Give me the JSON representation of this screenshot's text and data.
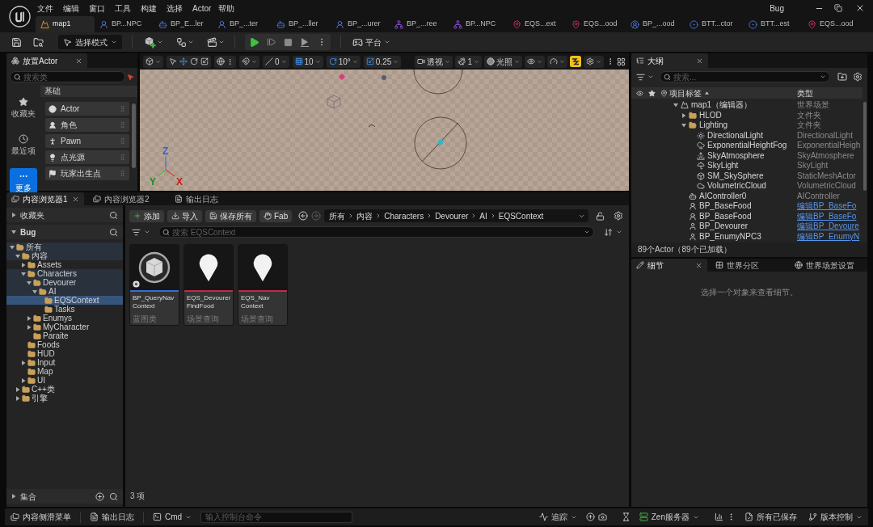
{
  "title_bar": {
    "menu": [
      "文件",
      "编辑",
      "窗口",
      "工具",
      "构建",
      "选择",
      "Actor",
      "帮助"
    ],
    "project": "Bug",
    "tabs": [
      {
        "label": "map1",
        "kind": "level",
        "selected": true
      },
      {
        "label": "BP...NPC",
        "kind": "character",
        "selected": false
      },
      {
        "label": "BP_E...ler",
        "kind": "controller",
        "selected": false
      },
      {
        "label": "BP_...ter",
        "kind": "character",
        "selected": false
      },
      {
        "label": "BP_...ller",
        "kind": "controller",
        "selected": false
      },
      {
        "label": "BP_...urer",
        "kind": "character",
        "selected": false
      },
      {
        "label": "BP_...ree",
        "kind": "behavior_tree",
        "selected": false
      },
      {
        "label": "BP...NPC",
        "kind": "behavior_tree",
        "selected": false
      },
      {
        "label": "EQS...ext",
        "kind": "query",
        "selected": false
      },
      {
        "label": "EQS...ood",
        "kind": "query",
        "selected": false
      },
      {
        "label": "BP_...ood",
        "kind": "blackboard",
        "selected": false
      },
      {
        "label": "BTT...ctor",
        "kind": "task",
        "selected": false
      },
      {
        "label": "BTT...est",
        "kind": "task",
        "selected": false
      },
      {
        "label": "EQS...ood",
        "kind": "query",
        "selected": false
      }
    ]
  },
  "main_toolbar": {
    "mode": "选择模式",
    "platforms": "平台"
  },
  "place_actors": {
    "tab": "放置Actor",
    "search_placeholder": "搜索类",
    "categories": [
      {
        "label": "收藏夹",
        "kind": "favorites",
        "selected": false
      },
      {
        "label": "最近项",
        "kind": "recent",
        "selected": false
      },
      {
        "label": "更多",
        "kind": "more",
        "selected": true
      }
    ],
    "section": "基础",
    "items": [
      {
        "label": "Actor",
        "kind": "actor"
      },
      {
        "label": "角色",
        "kind": "character"
      },
      {
        "label": "Pawn",
        "kind": "pawn"
      },
      {
        "label": "点光源",
        "kind": "point_light"
      },
      {
        "label": "玩家出生点",
        "kind": "player_start"
      }
    ]
  },
  "viewport": {
    "toolbar": {
      "surface_snap": "0",
      "grid_snap": "10",
      "rotation_snap": "10°",
      "scale_snap": "0.25",
      "view_mode": "透视",
      "camera_speed": "1",
      "lighting_mode": "光照"
    },
    "axis_labels": [
      {
        "label": "Z",
        "color": "#2f5fd8"
      },
      {
        "label": "Y",
        "color": "#1f8a1f"
      },
      {
        "label": "X",
        "color": "#c81e1e"
      }
    ]
  },
  "content_browser": {
    "tabs": [
      {
        "label": "内容浏览器1",
        "kind": "browser",
        "selected": true
      },
      {
        "label": "内容浏览器2",
        "kind": "browser",
        "selected": false
      },
      {
        "label": "输出日志",
        "kind": "log",
        "selected": false
      }
    ],
    "sources": {
      "favorites": {
        "label": "收藏夹",
        "expanded": false
      },
      "project": {
        "label": "Bug",
        "expanded": true
      },
      "tree": [
        {
          "label": "所有",
          "expanded": true,
          "selected": false,
          "highlighted": true,
          "children": [
            {
              "label": "内容",
              "expanded": true,
              "selected": false,
              "highlighted": true,
              "children": [
                {
                  "label": "Assets",
                  "expanded": false,
                  "selected": false,
                  "highlighted": false
                },
                {
                  "label": "Characters",
                  "expanded": true,
                  "selected": false,
                  "highlighted": true,
                  "children": [
                    {
                      "label": "Devourer",
                      "expanded": true,
                      "selected": false,
                      "highlighted": true,
                      "children": [
                        {
                          "label": "AI",
                          "expanded": true,
                          "selected": false,
                          "highlighted": true,
                          "children": [
                            {
                              "label": "EQSContext",
                              "selected": true,
                              "highlighted": false
                            },
                            {
                              "label": "Tasks",
                              "selected": false,
                              "highlighted": false
                            }
                          ]
                        }
                      ]
                    },
                    {
                      "label": "Enumys",
                      "expanded": false,
                      "selected": false,
                      "highlighted": false
                    },
                    {
                      "label": "MyCharacter",
                      "expanded": false,
                      "selected": false,
                      "highlighted": false
                    },
                    {
                      "label": "Paraite",
                      "selected": false,
                      "highlighted": false
                    }
                  ]
                },
                {
                  "label": "Foods",
                  "selected": false,
                  "highlighted": false
                },
                {
                  "label": "HUD",
                  "selected": false,
                  "highlighted": false
                },
                {
                  "label": "Input",
                  "expanded": false,
                  "selected": false,
                  "highlighted": false
                },
                {
                  "label": "Map",
                  "selected": false,
                  "highlighted": false
                },
                {
                  "label": "UI",
                  "expanded": false,
                  "selected": false,
                  "highlighted": false
                }
              ]
            },
            {
              "label": "C++类",
              "expanded": false,
              "selected": false,
              "highlighted": false
            },
            {
              "label": "引擎",
              "expanded": false,
              "selected": false,
              "highlighted": false
            }
          ]
        }
      ],
      "collections": {
        "label": "集合",
        "expanded": false
      }
    },
    "toolbar": [
      {
        "label": "添加",
        "kind": "add"
      },
      {
        "label": "导入",
        "kind": "import"
      },
      {
        "label": "保存所有",
        "kind": "save_all"
      },
      {
        "label": "Fab",
        "kind": "fab"
      }
    ],
    "nav": [
      {
        "kind": "back",
        "disabled": false
      },
      {
        "kind": "forward",
        "disabled": true
      }
    ],
    "path": [
      "所有",
      "内容",
      "Characters",
      "Devourer",
      "AI",
      "EQSContext"
    ],
    "search_placeholder": "搜索 EQSContext",
    "assets": [
      {
        "name_lines": [
          "BP_QueryNav",
          "Context"
        ],
        "type": "蓝图类",
        "kind": "blueprint",
        "color": "#3a6bd6"
      },
      {
        "name_lines": [
          "EQS_Devourer",
          "FindFood"
        ],
        "type": "场景查询",
        "kind": "query",
        "color": "#c0284c"
      },
      {
        "name_lines": [
          "EQS_Nav",
          "Context"
        ],
        "type": "场景查询",
        "kind": "query",
        "color": "#c0284c"
      }
    ],
    "item_count": "3 项"
  },
  "outliner": {
    "tab": "大纲",
    "search_placeholder": "搜索...",
    "columns": [
      "项目标签",
      "类型"
    ],
    "rows": [
      {
        "label": "map1（编辑器）",
        "type": "世界场景",
        "kind": "world",
        "type_link": false,
        "expanded": true,
        "children": [
          {
            "label": "HLOD",
            "type": "文件夹",
            "kind": "folder",
            "type_link": false,
            "expanded": false
          },
          {
            "label": "Lighting",
            "type": "文件夹",
            "kind": "folder",
            "type_link": false,
            "expanded": true,
            "children": [
              {
                "label": "DirectionalLight",
                "type": "DirectionalLight",
                "kind": "directional_light",
                "type_link": false
              },
              {
                "label": "ExponentialHeightFog",
                "type": "ExponentialHeigh",
                "kind": "fog",
                "type_link": false
              },
              {
                "label": "SkyAtmosphere",
                "type": "SkyAtmosphere",
                "kind": "atmosphere",
                "type_link": false
              },
              {
                "label": "SkyLight",
                "type": "SkyLight",
                "kind": "sky_light",
                "type_link": false
              },
              {
                "label": "SM_SkySphere",
                "type": "StaticMeshActor",
                "kind": "mesh",
                "type_link": false
              },
              {
                "label": "VolumetricCloud",
                "type": "VolumetricCloud",
                "kind": "cloud",
                "type_link": false
              }
            ]
          },
          {
            "label": "AIController0",
            "type": "AIController",
            "kind": "controller",
            "type_link": false
          },
          {
            "label": "BP_BaseFood",
            "type": "编辑BP_BaseFo",
            "kind": "blueprint_actor",
            "type_link": true
          },
          {
            "label": "BP_BaseFood",
            "type": "编辑BP_BaseFo",
            "kind": "blueprint_actor",
            "type_link": true
          },
          {
            "label": "BP_Devourer",
            "type": "编辑BP_Devoure",
            "kind": "blueprint_character",
            "type_link": true
          },
          {
            "label": "BP_EnumyNPC3",
            "type": "编辑BP_EnumyN",
            "kind": "blueprint_character",
            "type_link": true
          }
        ]
      }
    ],
    "status": "89个Actor（89个已加载）"
  },
  "details": {
    "tabs": [
      {
        "label": "细节",
        "kind": "details",
        "selected": true
      },
      {
        "label": "世界分区",
        "kind": "partition",
        "selected": false
      },
      {
        "label": "世界场景设置",
        "kind": "world_settings",
        "selected": false
      }
    ],
    "message": "选择一个对象来查看细节。"
  },
  "status_bar": {
    "left": [
      {
        "label": "内容侧滑菜单",
        "kind": "drawer"
      },
      {
        "label": "输出日志",
        "kind": "log"
      },
      {
        "label": "Cmd",
        "kind": "cmd"
      }
    ],
    "console_placeholder": "输入控制台命令",
    "right": [
      {
        "label": "追踪",
        "kind": "trace"
      },
      {
        "label": "Zen服务器",
        "kind": "zen"
      },
      {
        "label": "所有已保存",
        "kind": "saved"
      },
      {
        "label": "版本控制",
        "kind": "source_control"
      }
    ]
  }
}
